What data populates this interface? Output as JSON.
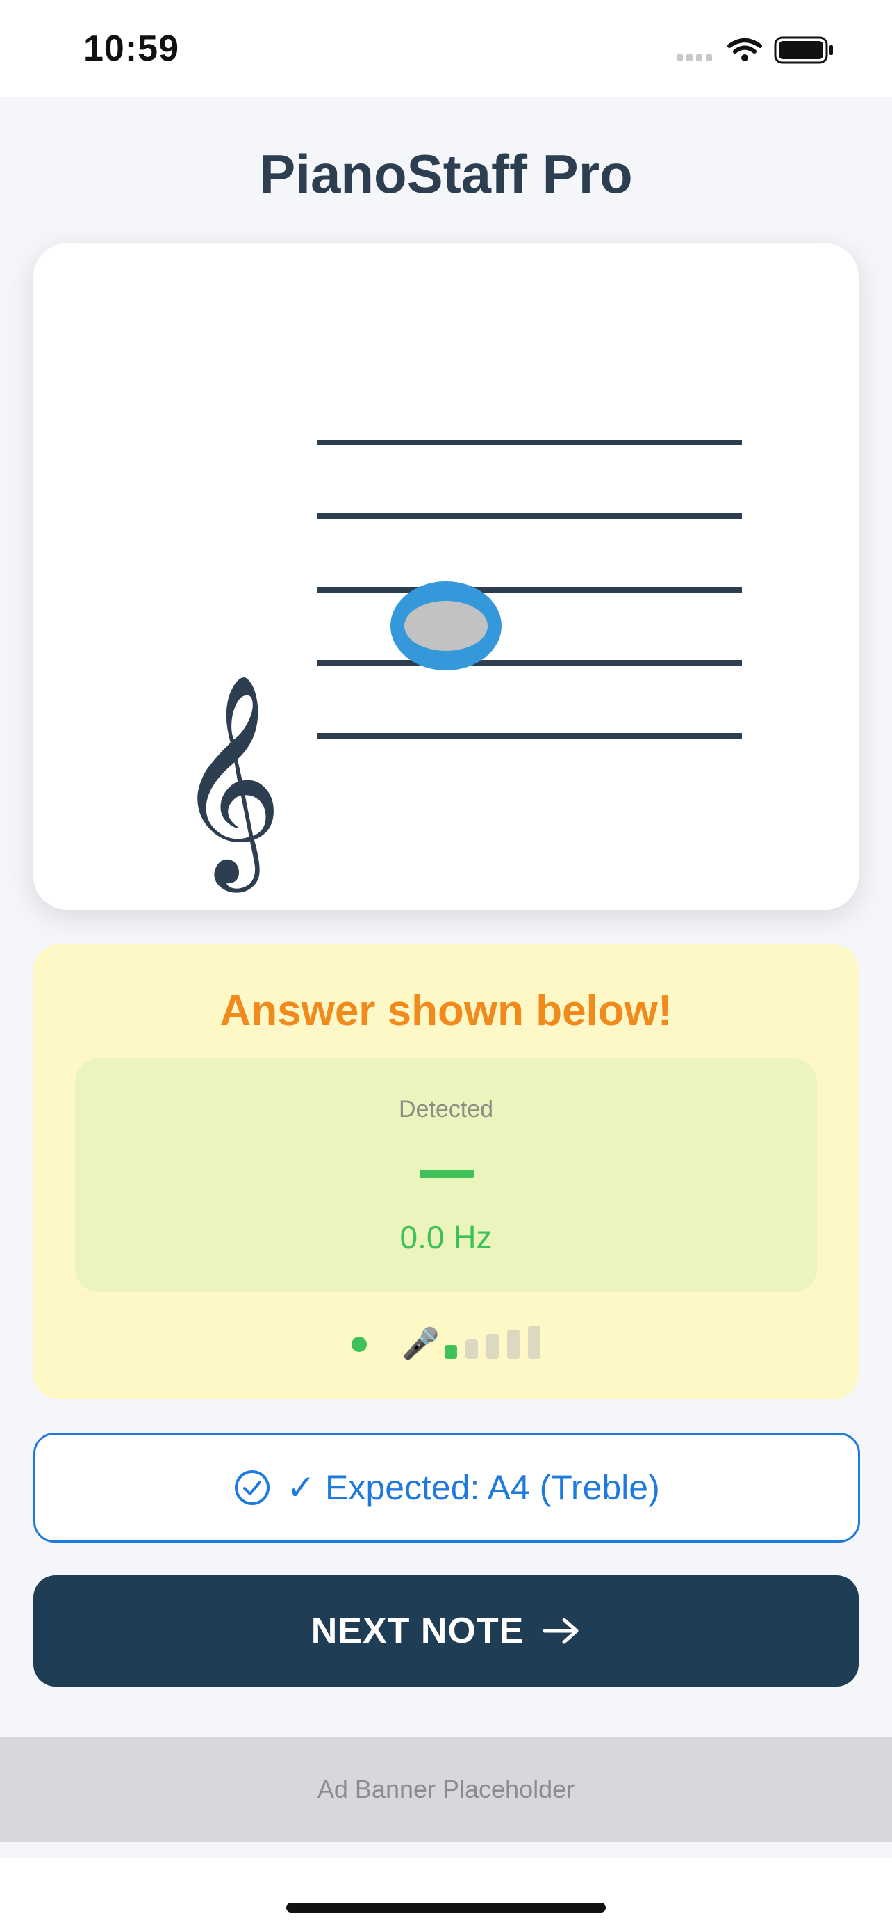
{
  "status_bar": {
    "time": "10:59"
  },
  "app": {
    "title": "PianoStaff Pro"
  },
  "staff": {
    "clef": "treble-clef-icon",
    "note_name": "A4",
    "clef_symbol": "𝄞"
  },
  "feedback": {
    "title": "Answer shown below!",
    "detected_label": "Detected",
    "detected_note": "—",
    "detected_frequency": "0.0 Hz",
    "mic_icon": "🎤",
    "input_level_bars_active": 1,
    "input_level_bars_total": 5
  },
  "expected": {
    "text": "✓ Expected: A4 (Treble)",
    "icon": "check-circle-icon"
  },
  "next_button": {
    "label": "NEXT NOTE",
    "icon": "arrow-right-icon"
  },
  "ad": {
    "text": "Ad Banner Placeholder"
  },
  "colors": {
    "accent": "#1f7ae0",
    "feedback_title": "#f08a1c",
    "detected_green": "#3fc15a",
    "note_outline": "#3498db",
    "button_bg": "#1f3d54"
  }
}
